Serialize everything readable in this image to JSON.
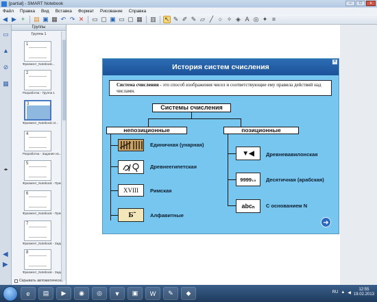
{
  "window": {
    "title": "[partial] - SMART Notebook",
    "buttons": [
      "–",
      "□",
      "x"
    ]
  },
  "menu": [
    "Файл",
    "Правка",
    "Вид",
    "Вставка",
    "Формат",
    "Рисование",
    "Справка"
  ],
  "sorter": {
    "header": "Группы",
    "group": "Группа 1",
    "thumbs": [
      {
        "num": "1",
        "caption": "Фрагмент_Notebook..."
      },
      {
        "num": "2",
        "caption": "Разработка - Группа 1"
      },
      {
        "num": "3",
        "caption": "Фрагмент_Notebook от..."
      },
      {
        "num": "4",
        "caption": "Разработка - Задание из..."
      },
      {
        "num": "5",
        "caption": "Фрагмент_Notebook - Прев..."
      },
      {
        "num": "6",
        "caption": "Фрагмент_Notebook - Прев..."
      },
      {
        "num": "7",
        "caption": "Фрагмент_Notebook - Зада..."
      },
      {
        "num": "8",
        "caption": "Фрагмент_Notebook - Зада..."
      }
    ],
    "auto_hide": "Скрывать автоматически"
  },
  "slide": {
    "title": "История систем счисления",
    "definition_bold": "Система счисления",
    "definition_rest": " - это способ изображения чисел и соответствующие ему правила действий над числами.",
    "root": "Системы счисления",
    "left_branch": "непозиционные",
    "right_branch": "позиционные",
    "left_items": [
      {
        "icon": "tally-icon",
        "label": "Единичная (унарная)"
      },
      {
        "icon": "hieroglyph-icon",
        "label": "Древнеегипетская"
      },
      {
        "icon": "roman-icon",
        "label": "Римская",
        "icon_text": "XVIII"
      },
      {
        "icon": "alphabet-icon",
        "label": "Алфавитные",
        "icon_text": "Б̃"
      }
    ],
    "right_items": [
      {
        "icon": "cuneiform-icon",
        "label": "Древневавилонская",
        "icon_text": "▼◀"
      },
      {
        "icon": "decimal-icon",
        "label": "Десятичная (арабская)",
        "icon_text": "9999₁₀"
      },
      {
        "icon": "base-n-icon",
        "label": "С основанием N",
        "icon_text": "abcₙ"
      }
    ]
  },
  "tray": {
    "lang": "RU",
    "time": "12:55",
    "date": "19.02.2013"
  },
  "colors": {
    "slide_bg": "#76c6ef",
    "slide_header": "#1c5299"
  }
}
